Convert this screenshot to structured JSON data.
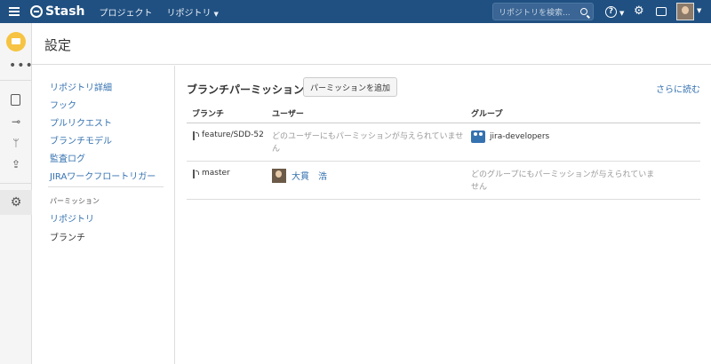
{
  "topbar": {
    "app_name": "Stash",
    "nav": [
      "プロジェクト",
      "リポジトリ"
    ],
    "search_placeholder": "リポジトリを検索...",
    "help_label": "?"
  },
  "header": {
    "title": "設定"
  },
  "settings_nav": {
    "links": [
      "リポジトリ詳細",
      "フック",
      "プルリクエスト",
      "ブランチモデル",
      "監査ログ",
      "JIRAワークフロートリガー"
    ],
    "section_heading": "パーミッション",
    "permission_links": [
      "リポジトリ",
      "ブランチ"
    ]
  },
  "main": {
    "section_title": "ブランチパーミッション",
    "add_button": "パーミッションを追加",
    "more_link": "さらに読む",
    "columns": [
      "ブランチ",
      "ユーザー",
      "グループ"
    ],
    "rows": [
      {
        "branch": "feature/SDD-52",
        "users": "どのユーザーにもパーミッションが与えられていません",
        "group": "jira-developers"
      },
      {
        "branch": "master",
        "user": "大貫　浩",
        "groups": "どのグループにもパーミッションが与えられていません"
      }
    ]
  }
}
